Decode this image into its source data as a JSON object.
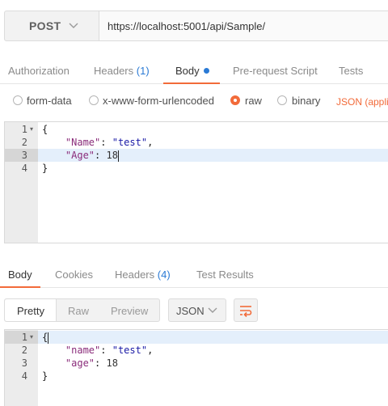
{
  "request": {
    "method": "POST",
    "url": "https://localhost:5001/api/Sample/"
  },
  "request_tabs": [
    {
      "label": "Authorization"
    },
    {
      "label": "Headers",
      "count": "(1)"
    },
    {
      "label": "Body",
      "active": true
    },
    {
      "label": "Pre-request Script"
    },
    {
      "label": "Tests"
    }
  ],
  "body_types": [
    {
      "label": "form-data",
      "selected": false
    },
    {
      "label": "x-www-form-urlencoded",
      "selected": false
    },
    {
      "label": "raw",
      "selected": true
    },
    {
      "label": "binary",
      "selected": false
    }
  ],
  "content_type": "JSON (applic",
  "request_body": {
    "line_numbers": [
      "1",
      "2",
      "3",
      "4"
    ],
    "lines": [
      {
        "text": "{"
      },
      {
        "key": "\"Name\"",
        "value": "\"test\"",
        "trail": ","
      },
      {
        "key": "\"Age\"",
        "value": "18",
        "trail": ""
      },
      {
        "text": "}"
      }
    ]
  },
  "response_tabs": [
    {
      "label": "Body",
      "active": true
    },
    {
      "label": "Cookies"
    },
    {
      "label": "Headers",
      "count": "(4)"
    },
    {
      "label": "Test Results"
    }
  ],
  "format_options": [
    "Pretty",
    "Raw",
    "Preview"
  ],
  "response_language": "JSON",
  "response_body": {
    "line_numbers": [
      "1",
      "2",
      "3",
      "4"
    ],
    "lines": [
      {
        "text": "{"
      },
      {
        "key": "\"name\"",
        "value": "\"test\"",
        "trail": ","
      },
      {
        "key": "\"age\"",
        "value": "18",
        "trail": ""
      },
      {
        "text": "}"
      }
    ]
  },
  "colors": {
    "accent": "#f26b3a",
    "count_blue": "#2a7ad5",
    "json_key": "#8a2c7a",
    "json_string": "#1a1aa6"
  },
  "icons": [
    "chevron-down-icon",
    "fold-arrow-icon",
    "wrap-lines-icon"
  ]
}
